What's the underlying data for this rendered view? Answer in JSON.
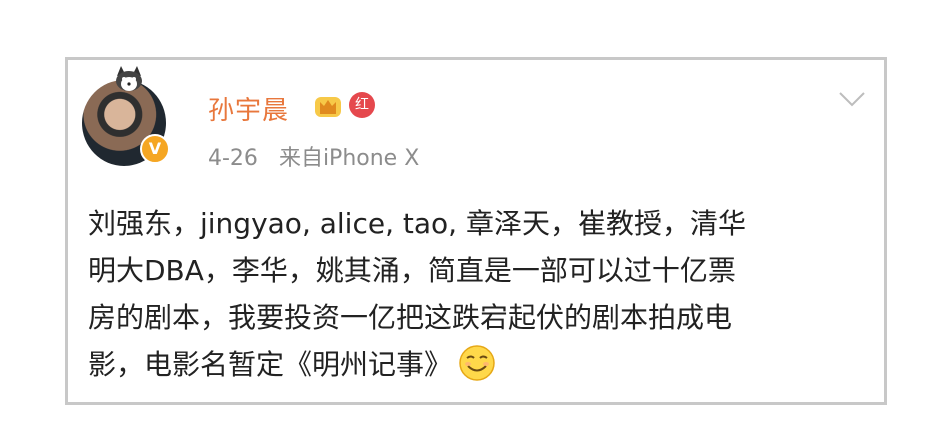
{
  "post": {
    "username": "孙宇晨",
    "badge_red_text": "红",
    "date": "4-26",
    "source": "来自iPhone X",
    "body_lines": [
      "刘强东，jingyao, alice, tao, 章泽天，崔教授，清华",
      "明大DBA，李华，姚其涌，简直是一部可以过十亿票",
      "房的剧本，我要投资一亿把这跌宕起伏的剧本拍成电",
      "影，电影名暂定《明州记事》"
    ]
  },
  "colors": {
    "username": "#e8773c",
    "meta": "#8c8c8c",
    "text": "#222222",
    "verified": "#f5a623",
    "card_border": "#c8c8c8"
  },
  "icons": {
    "verified": "verified-v-icon",
    "crown": "crown-badge-icon",
    "red_badge": "red-badge-icon",
    "chevron": "chevron-down-icon",
    "emoji": "smile-emoji-icon"
  }
}
